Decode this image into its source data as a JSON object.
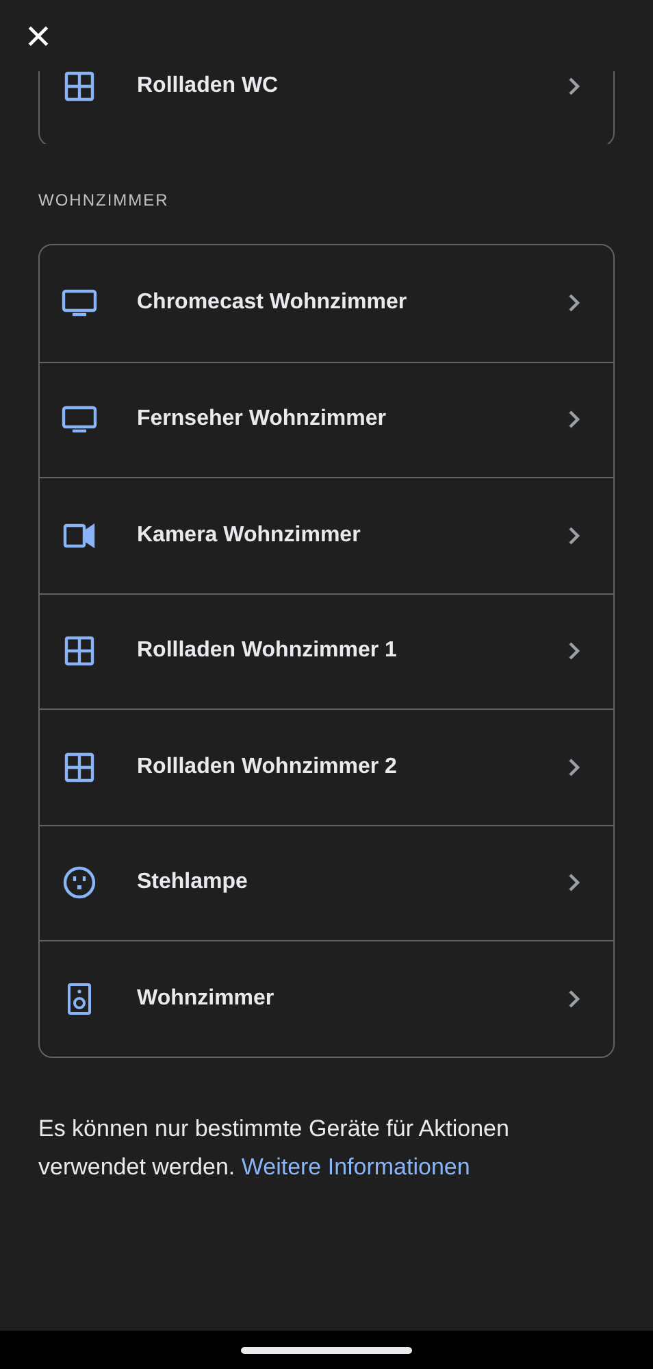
{
  "close_button": {
    "label": "×"
  },
  "previous_group": {
    "devices": [
      {
        "kind": "blinds",
        "name": "Rollladen WC"
      }
    ]
  },
  "group": {
    "title": "WOHNZIMMER",
    "devices": [
      {
        "kind": "tv",
        "name": "Chromecast Wohnzimmer"
      },
      {
        "kind": "tv",
        "name": "Fernseher Wohnzimmer"
      },
      {
        "kind": "camera",
        "name": "Kamera Wohnzimmer"
      },
      {
        "kind": "blinds",
        "name": "Rollladen Wohnzimmer 1"
      },
      {
        "kind": "blinds",
        "name": "Rollladen Wohnzimmer 2"
      },
      {
        "kind": "outlet",
        "name": "Stehlampe"
      },
      {
        "kind": "speaker",
        "name": "Wohnzimmer"
      }
    ]
  },
  "footer": {
    "text": "Es können nur bestimmte Geräte für Aktionen verwendet werden.",
    "link": "Weitere Informationen"
  }
}
